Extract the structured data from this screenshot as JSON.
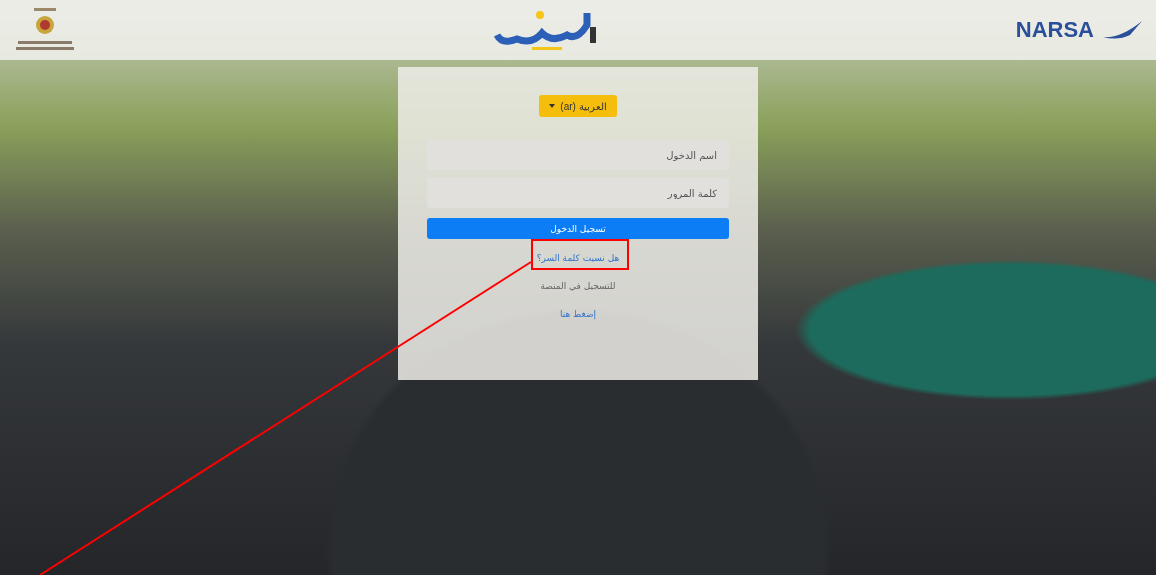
{
  "header": {
    "right_logo_text": "NARSA"
  },
  "login": {
    "language_button": "العربية (ar)",
    "username": {
      "placeholder": "اسم الدخول"
    },
    "password": {
      "placeholder": "كلمة المرور"
    },
    "submit": "تسجيل الدخول",
    "forgot_link": "هل نسيت كلمة السر؟",
    "register_text": "للتسجيل في المنصة",
    "register_link": "إضغط هنا"
  },
  "annotation": {
    "kind": "box-with-arrow"
  }
}
